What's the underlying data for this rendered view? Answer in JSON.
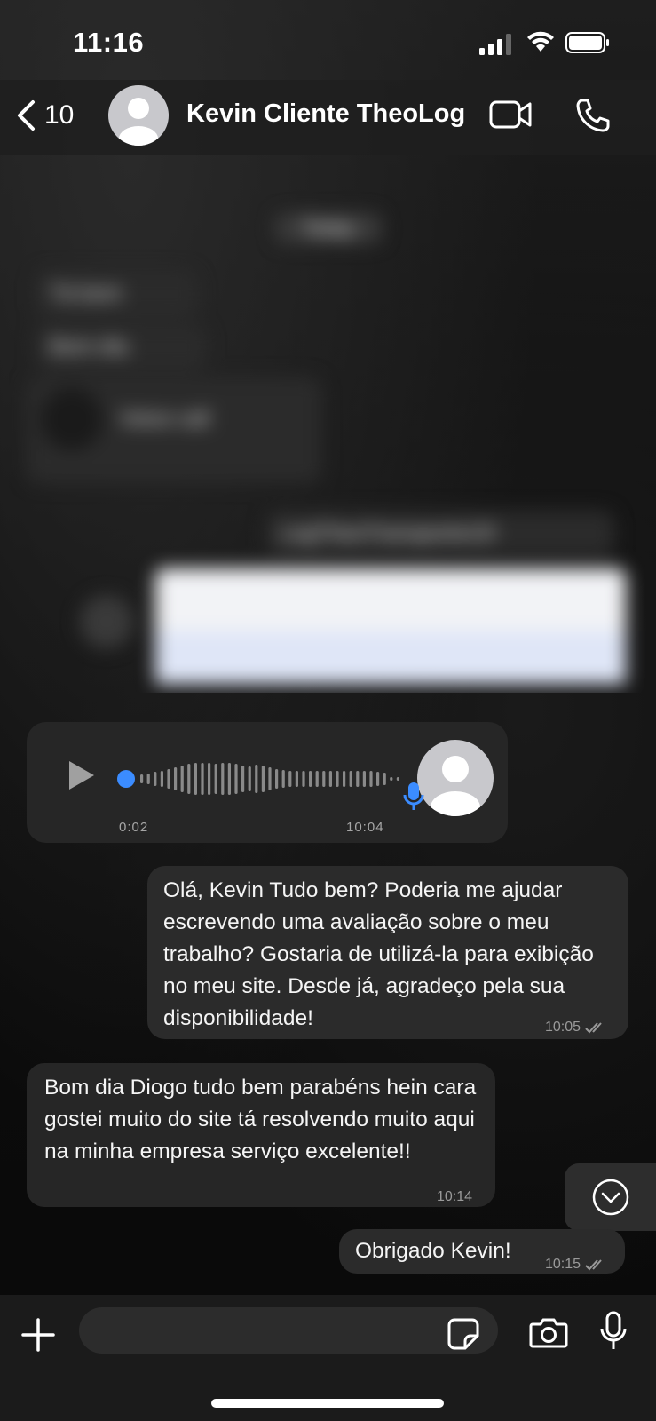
{
  "status": {
    "time": "11:16"
  },
  "header": {
    "back_count": "10",
    "contact_name": "Kevin Cliente TheoLog"
  },
  "blurred": {
    "today": "Today",
    "msg1": "Tá bom",
    "msg2": "Bom dia",
    "call_label": "Voice call",
    "credential": "LogTheoTransporte10!"
  },
  "voice": {
    "duration": "0:02",
    "time": "10:04"
  },
  "messages": [
    {
      "text": "Olá, Kevin Tudo bem? Poderia me ajudar escrevendo uma avaliação sobre o meu trabalho? Gostaria de utilizá-la para exibição no meu site. Desde já, agradeço pela sua disponibilidade!",
      "time": "10:05",
      "direction": "outgoing"
    },
    {
      "text": "Bom dia Diogo tudo bem parabéns hein cara gostei muito do site tá resolvendo muito aqui na minha empresa serviço excelente!!",
      "time": "10:14",
      "direction": "incoming"
    },
    {
      "text": "Obrigado Kevin!",
      "time": "10:15",
      "direction": "outgoing"
    }
  ],
  "colors": {
    "accent_blue": "#3b8cff",
    "bubble_out": "#2b2b2b",
    "bubble_in": "#262626"
  }
}
